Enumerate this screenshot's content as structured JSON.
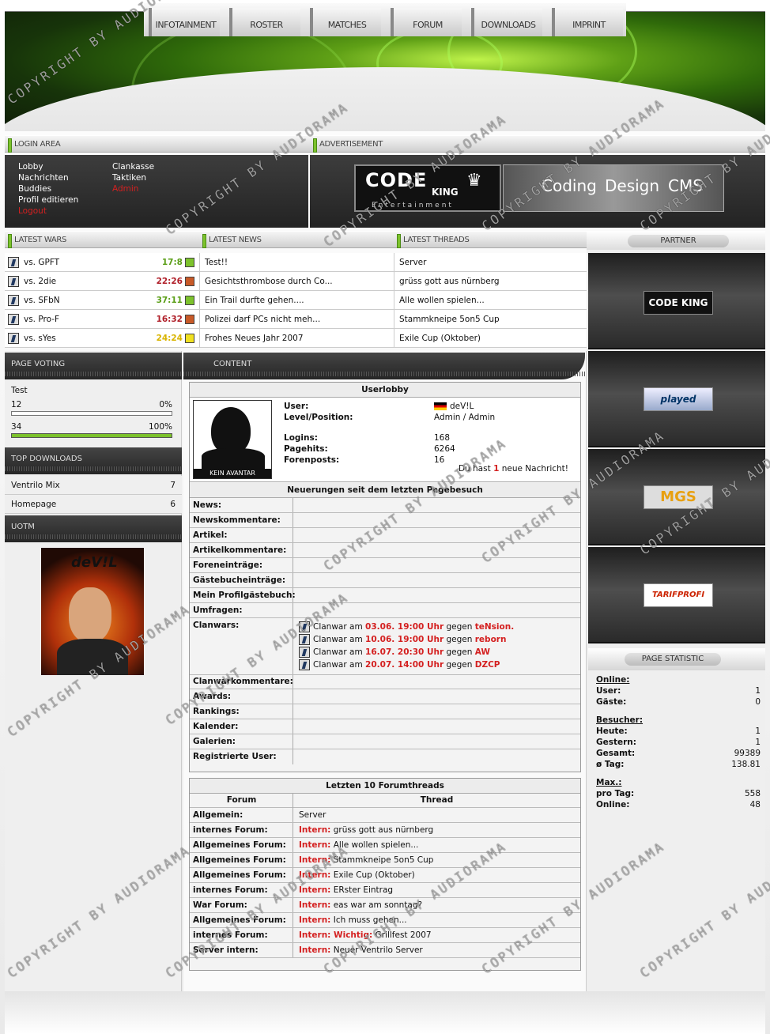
{
  "nav": [
    "INFOTAINMENT",
    "ROSTER",
    "MATCHES",
    "FORUM",
    "DOWNLOADS",
    "IMPRINT"
  ],
  "bars": {
    "login": "LOGIN AREA",
    "ad": "ADVERTISEMENT",
    "wars": "LATEST WARS",
    "news": "LATEST NEWS",
    "threads": "LATEST THREADS",
    "partner": "PARTNER",
    "voting": "PAGE VOTING",
    "content": "CONTENT",
    "downloads": "TOP DOWNLOADS",
    "uotm": "UOTM",
    "statistic": "PAGE STATISTIC"
  },
  "login": {
    "col1": [
      "Lobby",
      "Nachrichten",
      "Buddies",
      "Profil editieren",
      "Logout"
    ],
    "col2": [
      "Clankasse",
      "Taktiken",
      "Admin"
    ]
  },
  "ad": {
    "logo_word": "CODE",
    "logo_sub": "KING",
    "logo_tag": "Entertainment",
    "items": [
      "Coding",
      "Design",
      "CMS"
    ]
  },
  "wars": [
    {
      "opp": "vs. GPFT",
      "score": "17:8",
      "res": "win"
    },
    {
      "opp": "vs. 2die",
      "score": "22:26",
      "res": "loss"
    },
    {
      "opp": "vs. SFbN",
      "score": "37:11",
      "res": "win"
    },
    {
      "opp": "vs. Pro-F",
      "score": "16:32",
      "res": "loss"
    },
    {
      "opp": "vs. sYes",
      "score": "24:24",
      "res": "draw"
    }
  ],
  "news": [
    "Test!!",
    "Gesichtsthrombose durch Co...",
    "Ein Trail durfte gehen....",
    "Polizei darf PCs nicht meh...",
    "Frohes Neues Jahr 2007"
  ],
  "threads": [
    "Server",
    "grüss gott aus nürnberg",
    "Alle wollen spielen...",
    "Stammkneipe 5on5 Cup",
    "Exile Cup (Oktober)"
  ],
  "voting": {
    "question": "Test",
    "options": [
      {
        "value": "12",
        "pct": "0%",
        "fill": 0
      },
      {
        "value": "34",
        "pct": "100%",
        "fill": 1
      }
    ]
  },
  "downloads": [
    {
      "name": "Ventrilo Mix",
      "count": "7"
    },
    {
      "name": "Homepage",
      "count": "6"
    }
  ],
  "uotm": {
    "name": "deV!L"
  },
  "userlobby": {
    "title": "Userlobby",
    "avatar_text": "KEIN AVANTAR",
    "labels": [
      "User:",
      "Level/Position:",
      "Logins:",
      "Pagehits:",
      "Forenposts:"
    ],
    "values": [
      "deV!L",
      "Admin / Admin",
      "168",
      "6264",
      "16"
    ],
    "msg_pre": "Du hast",
    "msg_count": "1",
    "msg_post": "neue Nachricht!"
  },
  "updates": {
    "title": "Neuerungen seit dem letzten Pagebesuch",
    "labels": [
      "News:",
      "Newskommentare:",
      "Artikel:",
      "Artikelkommentare:",
      "Foreneinträge:",
      "Gästebucheinträge:",
      "Mein Profilgästebuch:",
      "Umfragen:",
      "Clanwars:",
      "Clanwarkommentare:",
      "Awards:",
      "Rankings:",
      "Kalender:",
      "Galerien:",
      "Registrierte User:"
    ],
    "clanwars": [
      {
        "pre": "Clanwar am",
        "date": "03.06. 19:00 Uhr",
        "mid": "gegen",
        "team": "teNsion."
      },
      {
        "pre": "Clanwar am",
        "date": "10.06. 19:00 Uhr",
        "mid": "gegen",
        "team": "reborn"
      },
      {
        "pre": "Clanwar am",
        "date": "16.07. 20:30 Uhr",
        "mid": "gegen",
        "team": "AW"
      },
      {
        "pre": "Clanwar am",
        "date": "20.07. 14:00 Uhr",
        "mid": "gegen",
        "team": "DZCP"
      }
    ]
  },
  "forum": {
    "title": "Letzten 10 Forumthreads",
    "col1": "Forum",
    "col2": "Thread",
    "rows": [
      {
        "forum": "Allgemein:",
        "tag": "",
        "thread": "Server"
      },
      {
        "forum": "internes Forum:",
        "tag": "Intern:",
        "thread": "grüss gott aus nürnberg"
      },
      {
        "forum": "Allgemeines Forum:",
        "tag": "Intern:",
        "thread": "Alle wollen spielen..."
      },
      {
        "forum": "Allgemeines Forum:",
        "tag": "Intern:",
        "thread": "Stammkneipe 5on5 Cup"
      },
      {
        "forum": "Allgemeines Forum:",
        "tag": "Intern:",
        "thread": "Exile Cup (Oktober)"
      },
      {
        "forum": "internes Forum:",
        "tag": "Intern:",
        "thread": "ERster Eintrag"
      },
      {
        "forum": "War Forum:",
        "tag": "Intern:",
        "thread": "eas war am sonntag?"
      },
      {
        "forum": "Allgemeines Forum:",
        "tag": "Intern:",
        "thread": "Ich muss gehen..."
      },
      {
        "forum": "internes Forum:",
        "tag": "Intern: Wichtig:",
        "thread": "Grillfest 2007"
      },
      {
        "forum": "Server intern:",
        "tag": "Intern:",
        "thread": "Neuer Ventrilo Server"
      }
    ]
  },
  "partners": [
    "CODE KING",
    "played",
    "MGS",
    "TARIFPROFI"
  ],
  "stats": {
    "online_h": "Online:",
    "online": [
      {
        "l": "User:",
        "v": "1"
      },
      {
        "l": "Gäste:",
        "v": "0"
      }
    ],
    "visitors_h": "Besucher:",
    "visitors": [
      {
        "l": "Heute:",
        "v": "1"
      },
      {
        "l": "Gestern:",
        "v": "1"
      },
      {
        "l": "Gesamt:",
        "v": "99389"
      },
      {
        "l": "ø Tag:",
        "v": "138.81"
      }
    ],
    "max_h": "Max.:",
    "max": [
      {
        "l": "pro Tag:",
        "v": "558"
      },
      {
        "l": "Online:",
        "v": "48"
      }
    ]
  },
  "watermark": "COPYRIGHT BY AUDIORAMA",
  "colors": {
    "accent": "#7cc22c",
    "red": "#d42020",
    "win": "#5a9e16",
    "loss": "#b0202a"
  }
}
